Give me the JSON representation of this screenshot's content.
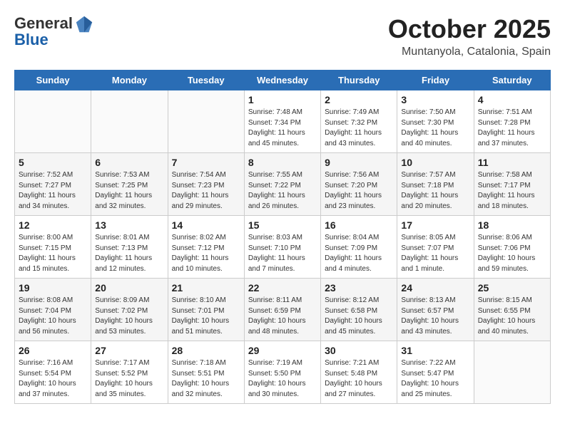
{
  "header": {
    "logo_general": "General",
    "logo_blue": "Blue",
    "month_title": "October 2025",
    "subtitle": "Muntanyola, Catalonia, Spain"
  },
  "days_of_week": [
    "Sunday",
    "Monday",
    "Tuesday",
    "Wednesday",
    "Thursday",
    "Friday",
    "Saturday"
  ],
  "weeks": [
    [
      {
        "day": "",
        "info": ""
      },
      {
        "day": "",
        "info": ""
      },
      {
        "day": "",
        "info": ""
      },
      {
        "day": "1",
        "info": "Sunrise: 7:48 AM\nSunset: 7:34 PM\nDaylight: 11 hours\nand 45 minutes."
      },
      {
        "day": "2",
        "info": "Sunrise: 7:49 AM\nSunset: 7:32 PM\nDaylight: 11 hours\nand 43 minutes."
      },
      {
        "day": "3",
        "info": "Sunrise: 7:50 AM\nSunset: 7:30 PM\nDaylight: 11 hours\nand 40 minutes."
      },
      {
        "day": "4",
        "info": "Sunrise: 7:51 AM\nSunset: 7:28 PM\nDaylight: 11 hours\nand 37 minutes."
      }
    ],
    [
      {
        "day": "5",
        "info": "Sunrise: 7:52 AM\nSunset: 7:27 PM\nDaylight: 11 hours\nand 34 minutes."
      },
      {
        "day": "6",
        "info": "Sunrise: 7:53 AM\nSunset: 7:25 PM\nDaylight: 11 hours\nand 32 minutes."
      },
      {
        "day": "7",
        "info": "Sunrise: 7:54 AM\nSunset: 7:23 PM\nDaylight: 11 hours\nand 29 minutes."
      },
      {
        "day": "8",
        "info": "Sunrise: 7:55 AM\nSunset: 7:22 PM\nDaylight: 11 hours\nand 26 minutes."
      },
      {
        "day": "9",
        "info": "Sunrise: 7:56 AM\nSunset: 7:20 PM\nDaylight: 11 hours\nand 23 minutes."
      },
      {
        "day": "10",
        "info": "Sunrise: 7:57 AM\nSunset: 7:18 PM\nDaylight: 11 hours\nand 20 minutes."
      },
      {
        "day": "11",
        "info": "Sunrise: 7:58 AM\nSunset: 7:17 PM\nDaylight: 11 hours\nand 18 minutes."
      }
    ],
    [
      {
        "day": "12",
        "info": "Sunrise: 8:00 AM\nSunset: 7:15 PM\nDaylight: 11 hours\nand 15 minutes."
      },
      {
        "day": "13",
        "info": "Sunrise: 8:01 AM\nSunset: 7:13 PM\nDaylight: 11 hours\nand 12 minutes."
      },
      {
        "day": "14",
        "info": "Sunrise: 8:02 AM\nSunset: 7:12 PM\nDaylight: 11 hours\nand 10 minutes."
      },
      {
        "day": "15",
        "info": "Sunrise: 8:03 AM\nSunset: 7:10 PM\nDaylight: 11 hours\nand 7 minutes."
      },
      {
        "day": "16",
        "info": "Sunrise: 8:04 AM\nSunset: 7:09 PM\nDaylight: 11 hours\nand 4 minutes."
      },
      {
        "day": "17",
        "info": "Sunrise: 8:05 AM\nSunset: 7:07 PM\nDaylight: 11 hours\nand 1 minute."
      },
      {
        "day": "18",
        "info": "Sunrise: 8:06 AM\nSunset: 7:06 PM\nDaylight: 10 hours\nand 59 minutes."
      }
    ],
    [
      {
        "day": "19",
        "info": "Sunrise: 8:08 AM\nSunset: 7:04 PM\nDaylight: 10 hours\nand 56 minutes."
      },
      {
        "day": "20",
        "info": "Sunrise: 8:09 AM\nSunset: 7:02 PM\nDaylight: 10 hours\nand 53 minutes."
      },
      {
        "day": "21",
        "info": "Sunrise: 8:10 AM\nSunset: 7:01 PM\nDaylight: 10 hours\nand 51 minutes."
      },
      {
        "day": "22",
        "info": "Sunrise: 8:11 AM\nSunset: 6:59 PM\nDaylight: 10 hours\nand 48 minutes."
      },
      {
        "day": "23",
        "info": "Sunrise: 8:12 AM\nSunset: 6:58 PM\nDaylight: 10 hours\nand 45 minutes."
      },
      {
        "day": "24",
        "info": "Sunrise: 8:13 AM\nSunset: 6:57 PM\nDaylight: 10 hours\nand 43 minutes."
      },
      {
        "day": "25",
        "info": "Sunrise: 8:15 AM\nSunset: 6:55 PM\nDaylight: 10 hours\nand 40 minutes."
      }
    ],
    [
      {
        "day": "26",
        "info": "Sunrise: 7:16 AM\nSunset: 5:54 PM\nDaylight: 10 hours\nand 37 minutes."
      },
      {
        "day": "27",
        "info": "Sunrise: 7:17 AM\nSunset: 5:52 PM\nDaylight: 10 hours\nand 35 minutes."
      },
      {
        "day": "28",
        "info": "Sunrise: 7:18 AM\nSunset: 5:51 PM\nDaylight: 10 hours\nand 32 minutes."
      },
      {
        "day": "29",
        "info": "Sunrise: 7:19 AM\nSunset: 5:50 PM\nDaylight: 10 hours\nand 30 minutes."
      },
      {
        "day": "30",
        "info": "Sunrise: 7:21 AM\nSunset: 5:48 PM\nDaylight: 10 hours\nand 27 minutes."
      },
      {
        "day": "31",
        "info": "Sunrise: 7:22 AM\nSunset: 5:47 PM\nDaylight: 10 hours\nand 25 minutes."
      },
      {
        "day": "",
        "info": ""
      }
    ]
  ]
}
